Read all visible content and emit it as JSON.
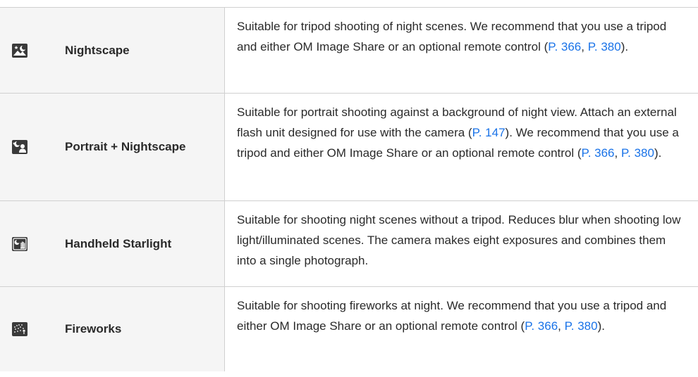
{
  "rows": [
    {
      "icon": "nightscape-icon",
      "name": "Nightscape",
      "desc_a": "Suitable for tripod shooting of night scenes. We recommend that you use a tripod and either OM Image Share or an optional remote control (",
      "link_1": "P. 366",
      "sep": ", ",
      "link_2": "P. 380",
      "desc_end": ")."
    },
    {
      "icon": "portrait-nightscape-icon",
      "name": "Portrait + Nightscape",
      "desc_a": "Suitable for portrait shooting against a background of night view. Attach an external flash unit designed for use with the camera (",
      "link_0": "P. 147",
      "desc_b": "). We recommend that you use a tripod and either OM Image Share or an optional remote control (",
      "link_1": "P. 366",
      "sep": ", ",
      "link_2": "P. 380",
      "desc_end": ")."
    },
    {
      "icon": "handheld-starlight-icon",
      "name": "Handheld Starlight",
      "desc_a": "Suitable for shooting night scenes without a tripod. Reduces blur when shooting low light/illuminated scenes. The camera makes eight exposures and combines them into a single photograph."
    },
    {
      "icon": "fireworks-icon",
      "name": "Fireworks",
      "desc_a": "Suitable for shooting fireworks at night. We recommend that you use a tripod and either OM Image Share or an optional remote control (",
      "link_1": "P. 366",
      "sep": ", ",
      "link_2": "P. 380",
      "desc_end": ")."
    }
  ],
  "colors": {
    "link": "#1a73e8",
    "icon_bg": "#3a3a3a",
    "border": "#d0d0d0"
  }
}
